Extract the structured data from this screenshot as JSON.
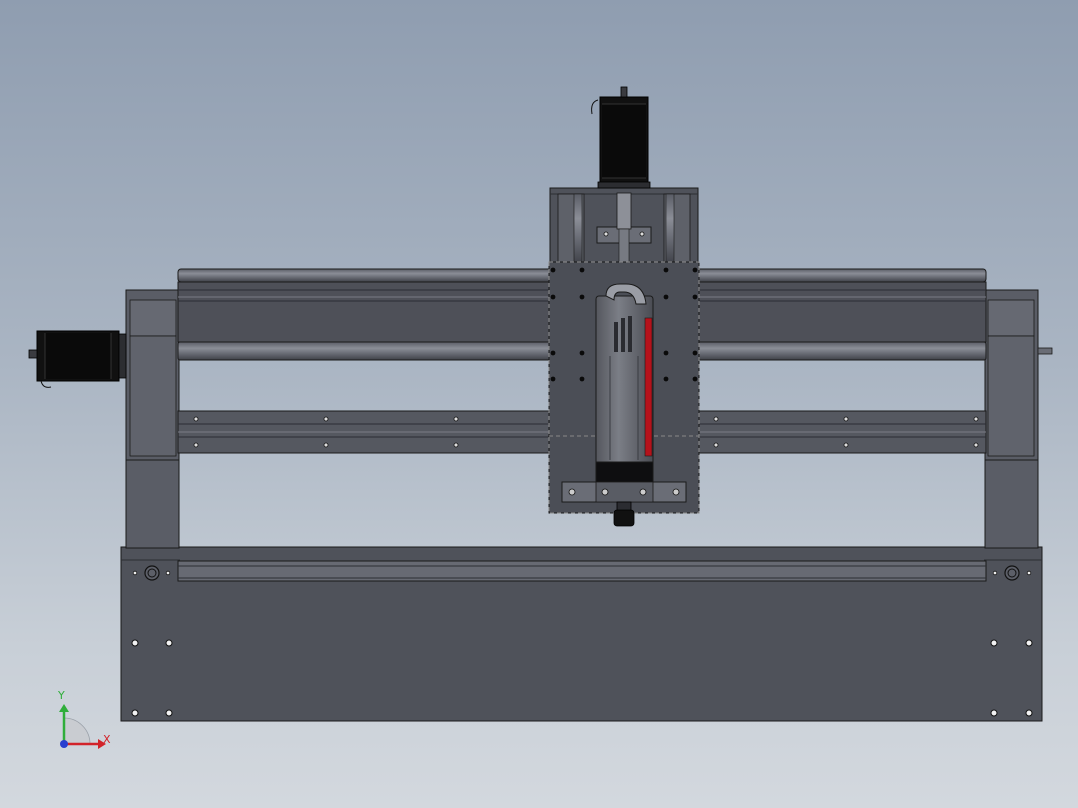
{
  "view": {
    "background_top": "#8f9db0",
    "background_bottom": "#d3d8de"
  },
  "colors": {
    "frame_dark": "#4e5058",
    "frame_mid": "#5c5f68",
    "frame_light": "#70737c",
    "rod": "#6a6d76",
    "motor_body": "#111111",
    "accent_red": "#b5121b",
    "outline": "#1a1a1a"
  },
  "triad": {
    "x_label": "X",
    "y_label": "Y",
    "x_color": "#d2232a",
    "y_color": "#2fae3a",
    "z_color": "#2a3fcf"
  }
}
